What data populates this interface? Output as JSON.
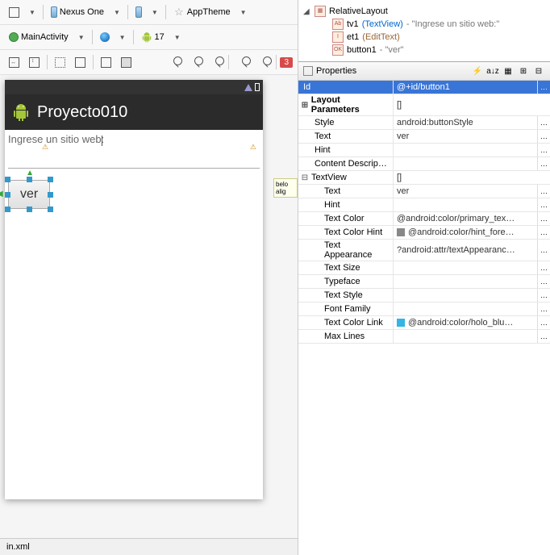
{
  "toolbar": {
    "device": "Nexus One",
    "theme": "AppTheme",
    "activity": "MainActivity",
    "api": "17",
    "warning_count": "3"
  },
  "design": {
    "app_title": "Proyecto010",
    "tv_text": "Ingrese un sitio web:",
    "button_text": "ver",
    "lint_side": "belo\nalig"
  },
  "outline": {
    "root": "RelativeLayout",
    "tv_id": "tv1",
    "tv_type": "(TextView)",
    "tv_desc": " - \"Ingrese un sitio web:\"",
    "et_id": "et1",
    "et_type": "(EditText)",
    "btn_id": "button1",
    "btn_desc": " - \"ver\""
  },
  "properties": {
    "title": "Properties",
    "rows": {
      "id_label": "Id",
      "id_val": "@+id/button1",
      "layout_params": "Layout Parameters",
      "layout_params_val": "[]",
      "style": "Style",
      "style_val": "android:buttonStyle",
      "text": "Text",
      "text_val": "ver",
      "hint": "Hint",
      "content_desc": "Content Descrip…",
      "textview": "TextView",
      "textview_val": "[]",
      "tv_text": "Text",
      "tv_text_val": "ver",
      "tv_hint": "Hint",
      "text_color": "Text Color",
      "text_color_val": "@android:color/primary_tex…",
      "text_color_hint": "Text Color Hint",
      "text_color_hint_val": "@android:color/hint_fore…",
      "text_appearance": "Text Appearance",
      "text_appearance_val": "?android:attr/textAppearanc…",
      "text_size": "Text Size",
      "typeface": "Typeface",
      "text_style": "Text Style",
      "font_family": "Font Family",
      "text_color_link": "Text Color Link",
      "text_color_link_val": "@android:color/holo_blu…",
      "max_lines": "Max Lines"
    }
  },
  "footer": {
    "tab": "in.xml"
  }
}
